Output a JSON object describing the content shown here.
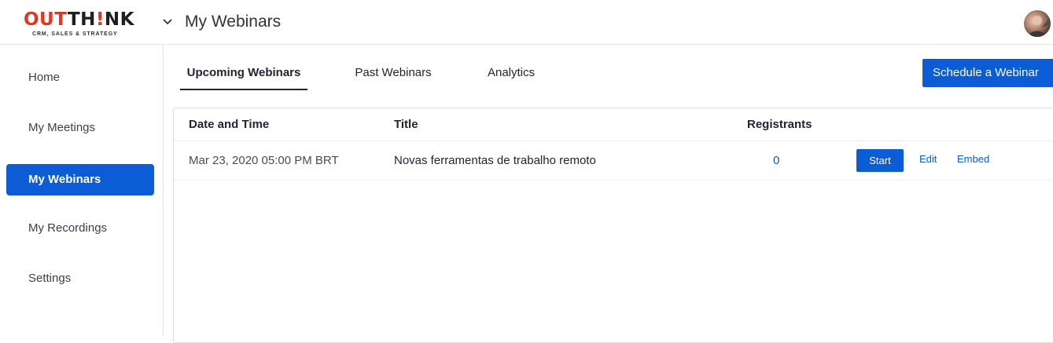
{
  "logo": {
    "part1": "OU",
    "part2": "T",
    "part3": "TH",
    "part4": "!",
    "part5": "NK",
    "tagline": "CRM, SALES & STRATEGY"
  },
  "header": {
    "title": "My Webinars",
    "chevron_icon": "chevron-down-icon",
    "avatar_icon": "user-avatar"
  },
  "sidebar": {
    "items": [
      {
        "label": "Home",
        "active": false
      },
      {
        "label": "My Meetings",
        "active": false
      },
      {
        "label": "My Webinars",
        "active": true
      },
      {
        "label": "My Recordings",
        "active": false
      },
      {
        "label": "Settings",
        "active": false
      }
    ]
  },
  "tabs": [
    {
      "label": "Upcoming Webinars",
      "active": true
    },
    {
      "label": "Past Webinars",
      "active": false
    },
    {
      "label": "Analytics",
      "active": false
    }
  ],
  "actions": {
    "schedule_label": "Schedule a Webinar"
  },
  "table": {
    "headers": {
      "datetime": "Date and Time",
      "title": "Title",
      "registrants": "Registrants"
    },
    "rows": [
      {
        "datetime": "Mar 23, 2020 05:00 PM BRT",
        "title": "Novas ferramentas de trabalho remoto",
        "registrants": "0",
        "start_label": "Start",
        "edit_label": "Edit",
        "embed_label": "Embed"
      }
    ]
  },
  "colors": {
    "accent": "#0b5cd5",
    "logo_red": "#e8351d",
    "text": "#232333",
    "border": "#e4e4e4"
  }
}
